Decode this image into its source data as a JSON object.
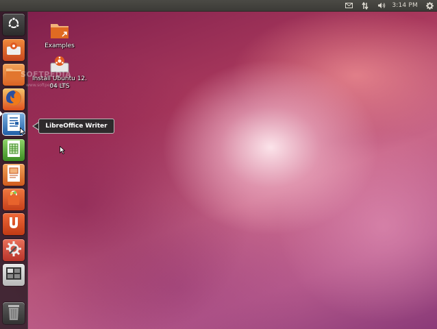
{
  "top_panel": {
    "clock": "3:14 PM",
    "icons": [
      "mail-icon",
      "network-icon",
      "volume-icon",
      "session-gear-icon"
    ]
  },
  "launcher": {
    "items": [
      {
        "name": "dash-home",
        "icon": "ubuntu-logo-icon"
      },
      {
        "name": "install-ubuntu",
        "icon": "installer-icon"
      },
      {
        "name": "files",
        "icon": "folder-icon"
      },
      {
        "name": "firefox",
        "icon": "firefox-icon"
      },
      {
        "name": "libreoffice-writer",
        "icon": "writer-icon",
        "active": true
      },
      {
        "name": "libreoffice-calc",
        "icon": "calc-icon"
      },
      {
        "name": "libreoffice-impress",
        "icon": "impress-icon"
      },
      {
        "name": "software-center",
        "icon": "shopping-bag-icon"
      },
      {
        "name": "ubuntu-one",
        "icon": "ubuntu-one-icon"
      },
      {
        "name": "system-settings",
        "icon": "settings-icon"
      },
      {
        "name": "workspace-switcher",
        "icon": "workspaces-icon"
      },
      {
        "name": "trash",
        "icon": "trash-icon"
      }
    ]
  },
  "tooltip": {
    "text": "LibreOffice Writer"
  },
  "desktop": {
    "icons": [
      {
        "label": "Examples"
      },
      {
        "label": "Install Ubuntu 12.04 LTS",
        "label_lines": [
          "Install Ubuntu 12.",
          "04 LTS"
        ]
      }
    ],
    "watermark": "SOFTPEDIA",
    "watermark_url": "www.softpedia.com"
  },
  "colors": {
    "panel": "#3c3b37",
    "launcher": "#281c24",
    "accent": "#dd4814"
  }
}
